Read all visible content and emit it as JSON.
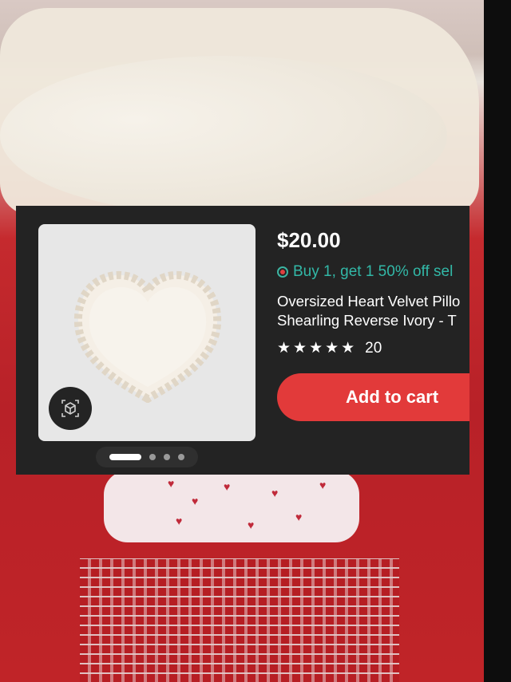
{
  "product": {
    "price": "$20.00",
    "promo": "Buy 1, get 1 50% off sel",
    "title_line1": "Oversized Heart Velvet Pillo",
    "title_line2": "Shearling Reverse Ivory - T",
    "stars": "★★★★★",
    "review_count": "20",
    "add_to_cart_label": "Add to cart",
    "image_count": 4,
    "active_image_index": 0
  },
  "icons": {
    "promo": "target-circle-icon",
    "ar_view": "3d-cube-icon",
    "rating": "star-icon"
  },
  "colors": {
    "card_bg": "#232323",
    "accent_red": "#e23a3a",
    "promo_teal": "#32b8a7"
  }
}
